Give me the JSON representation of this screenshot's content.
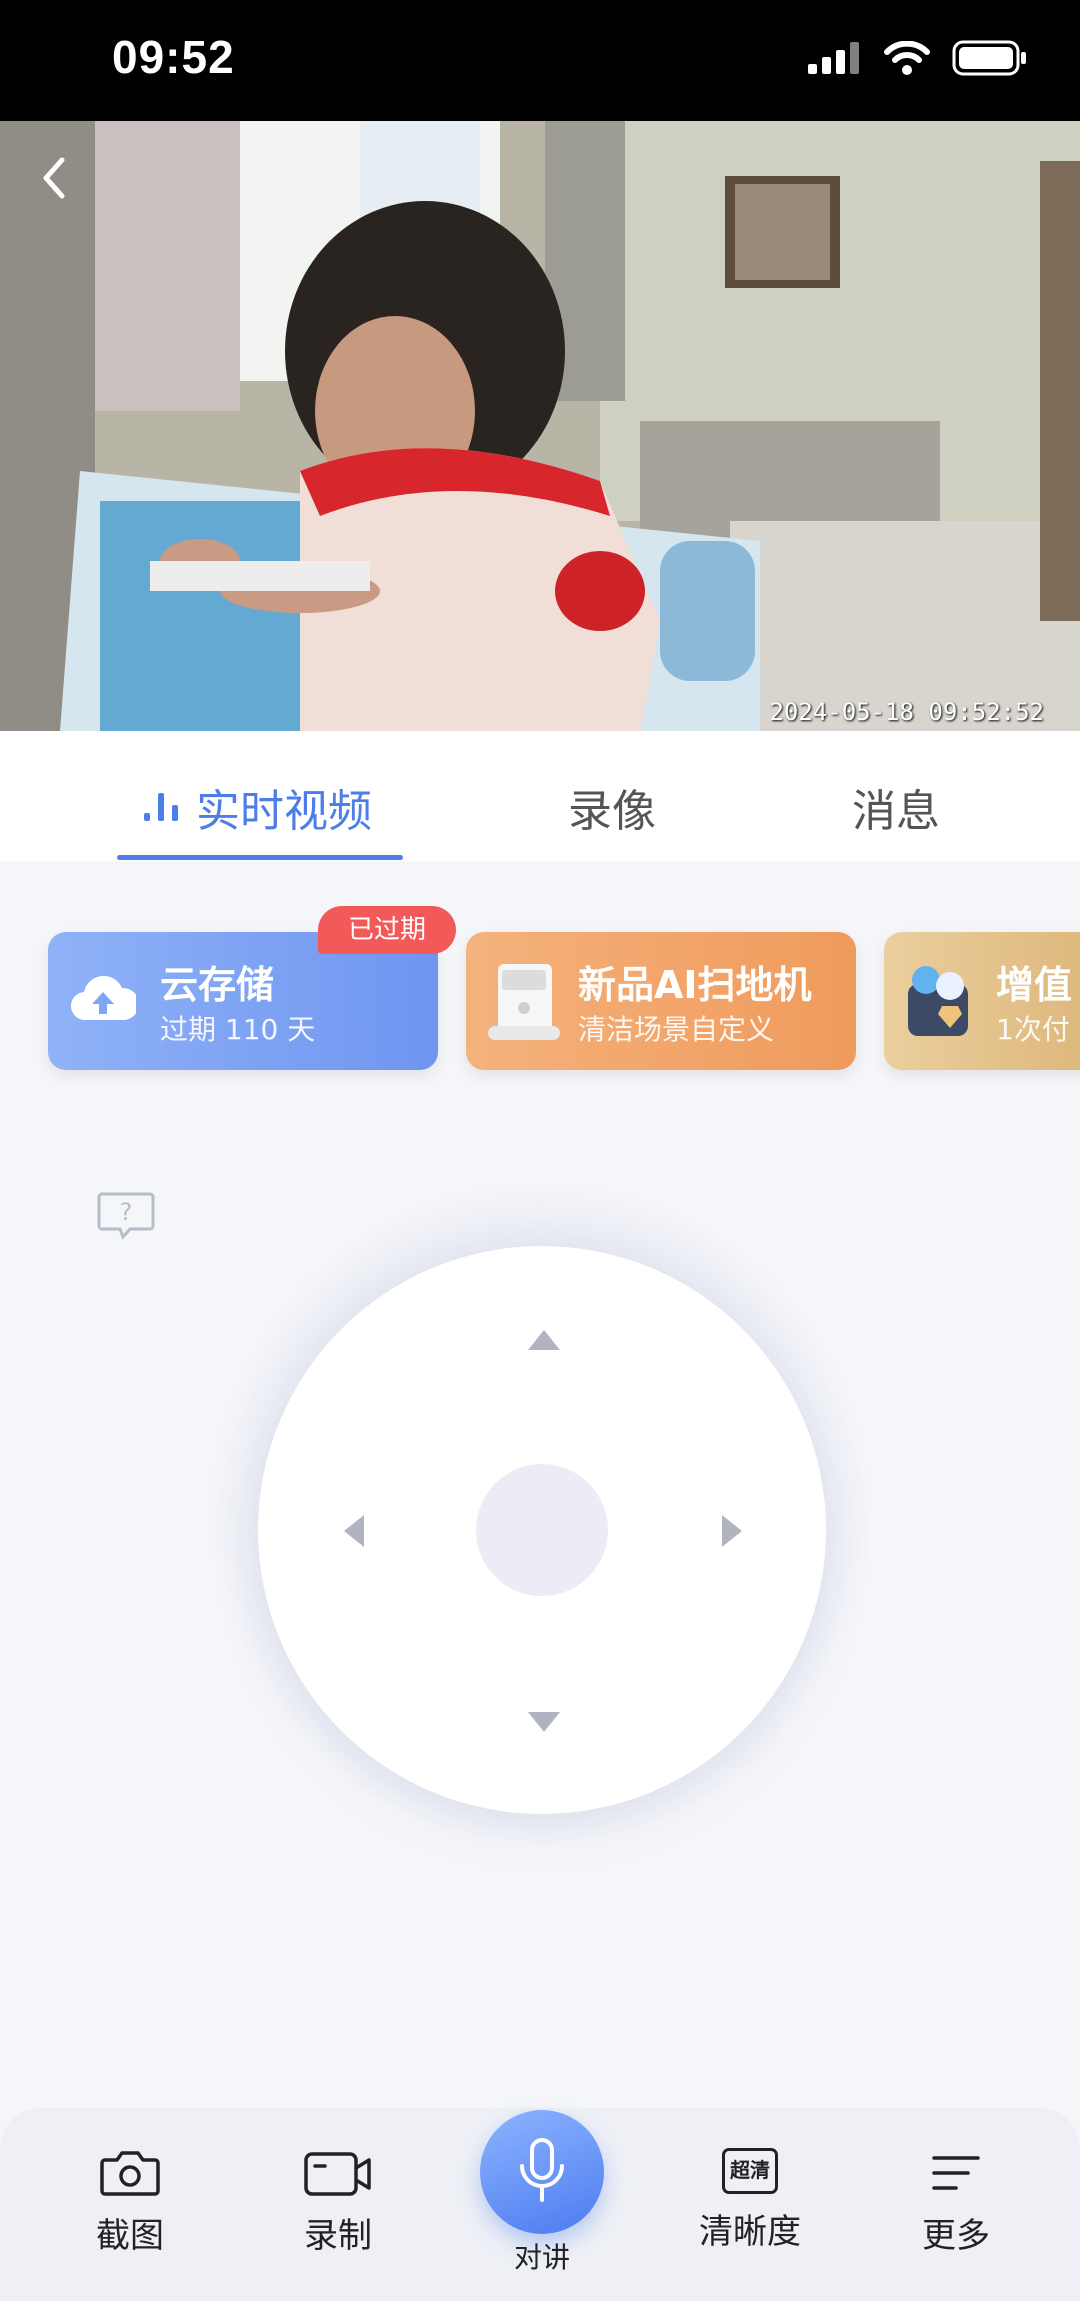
{
  "status_bar": {
    "time": "09:52"
  },
  "video": {
    "timestamp": "2024-05-18 09:52:52"
  },
  "tabs": [
    {
      "label": "实时视频",
      "active": true
    },
    {
      "label": "录像",
      "active": false
    },
    {
      "label": "消息",
      "active": false
    }
  ],
  "cards": [
    {
      "title": "云存储",
      "subtitle": "过期 110 天",
      "badge": "已过期"
    },
    {
      "title": "新品AI扫地机",
      "subtitle": "清洁场景自定义"
    },
    {
      "title": "增值",
      "subtitle": "1次付"
    }
  ],
  "bottom_bar": {
    "screenshot_label": "截图",
    "record_label": "录制",
    "talk_label": "对讲",
    "quality_label": "清晰度",
    "quality_icon_text": "超清",
    "more_label": "更多"
  },
  "colors": {
    "accent": "#4d7ee8",
    "badge": "#f25a5a",
    "card_cloud": "#7fa6f5",
    "card_ai": "#f2a466",
    "card_value": "#e4c28b"
  },
  "icons": [
    "signal-icon",
    "wifi-icon",
    "battery-icon",
    "back-icon",
    "live-bars-icon",
    "cloud-upload-icon",
    "help-icon",
    "camera-icon",
    "video-record-icon",
    "microphone-icon",
    "hd-icon",
    "menu-icon"
  ]
}
